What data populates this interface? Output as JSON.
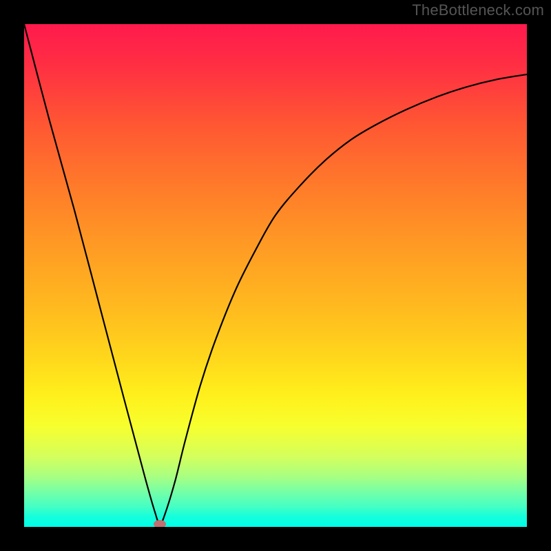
{
  "watermark": "TheBottleneck.com",
  "colors": {
    "frame": "#000000",
    "curve": "#000000",
    "marker": "#c07070",
    "gradient_top": "#ff1a4d",
    "gradient_bottom": "#00ffe8"
  },
  "chart_data": {
    "type": "line",
    "title": "",
    "xlabel": "",
    "ylabel": "",
    "xlim": [
      0,
      100
    ],
    "ylim": [
      0,
      100
    ],
    "grid": false,
    "series": [
      {
        "name": "bottleneck-curve",
        "x": [
          0,
          5,
          10,
          15,
          20,
          24,
          26,
          27,
          28,
          30,
          32,
          35,
          38,
          42,
          46,
          50,
          55,
          60,
          65,
          70,
          76,
          82,
          88,
          94,
          100
        ],
        "y": [
          100,
          81,
          63,
          44,
          25,
          10,
          3,
          0.5,
          2.5,
          9,
          17,
          28,
          37,
          47,
          55,
          62,
          68,
          73,
          77,
          80,
          83,
          85.5,
          87.5,
          89,
          90
        ]
      }
    ],
    "annotations": [
      {
        "name": "min-marker",
        "x": 27,
        "y": 0.5
      }
    ],
    "background": "vertical-gradient-red-to-green"
  }
}
